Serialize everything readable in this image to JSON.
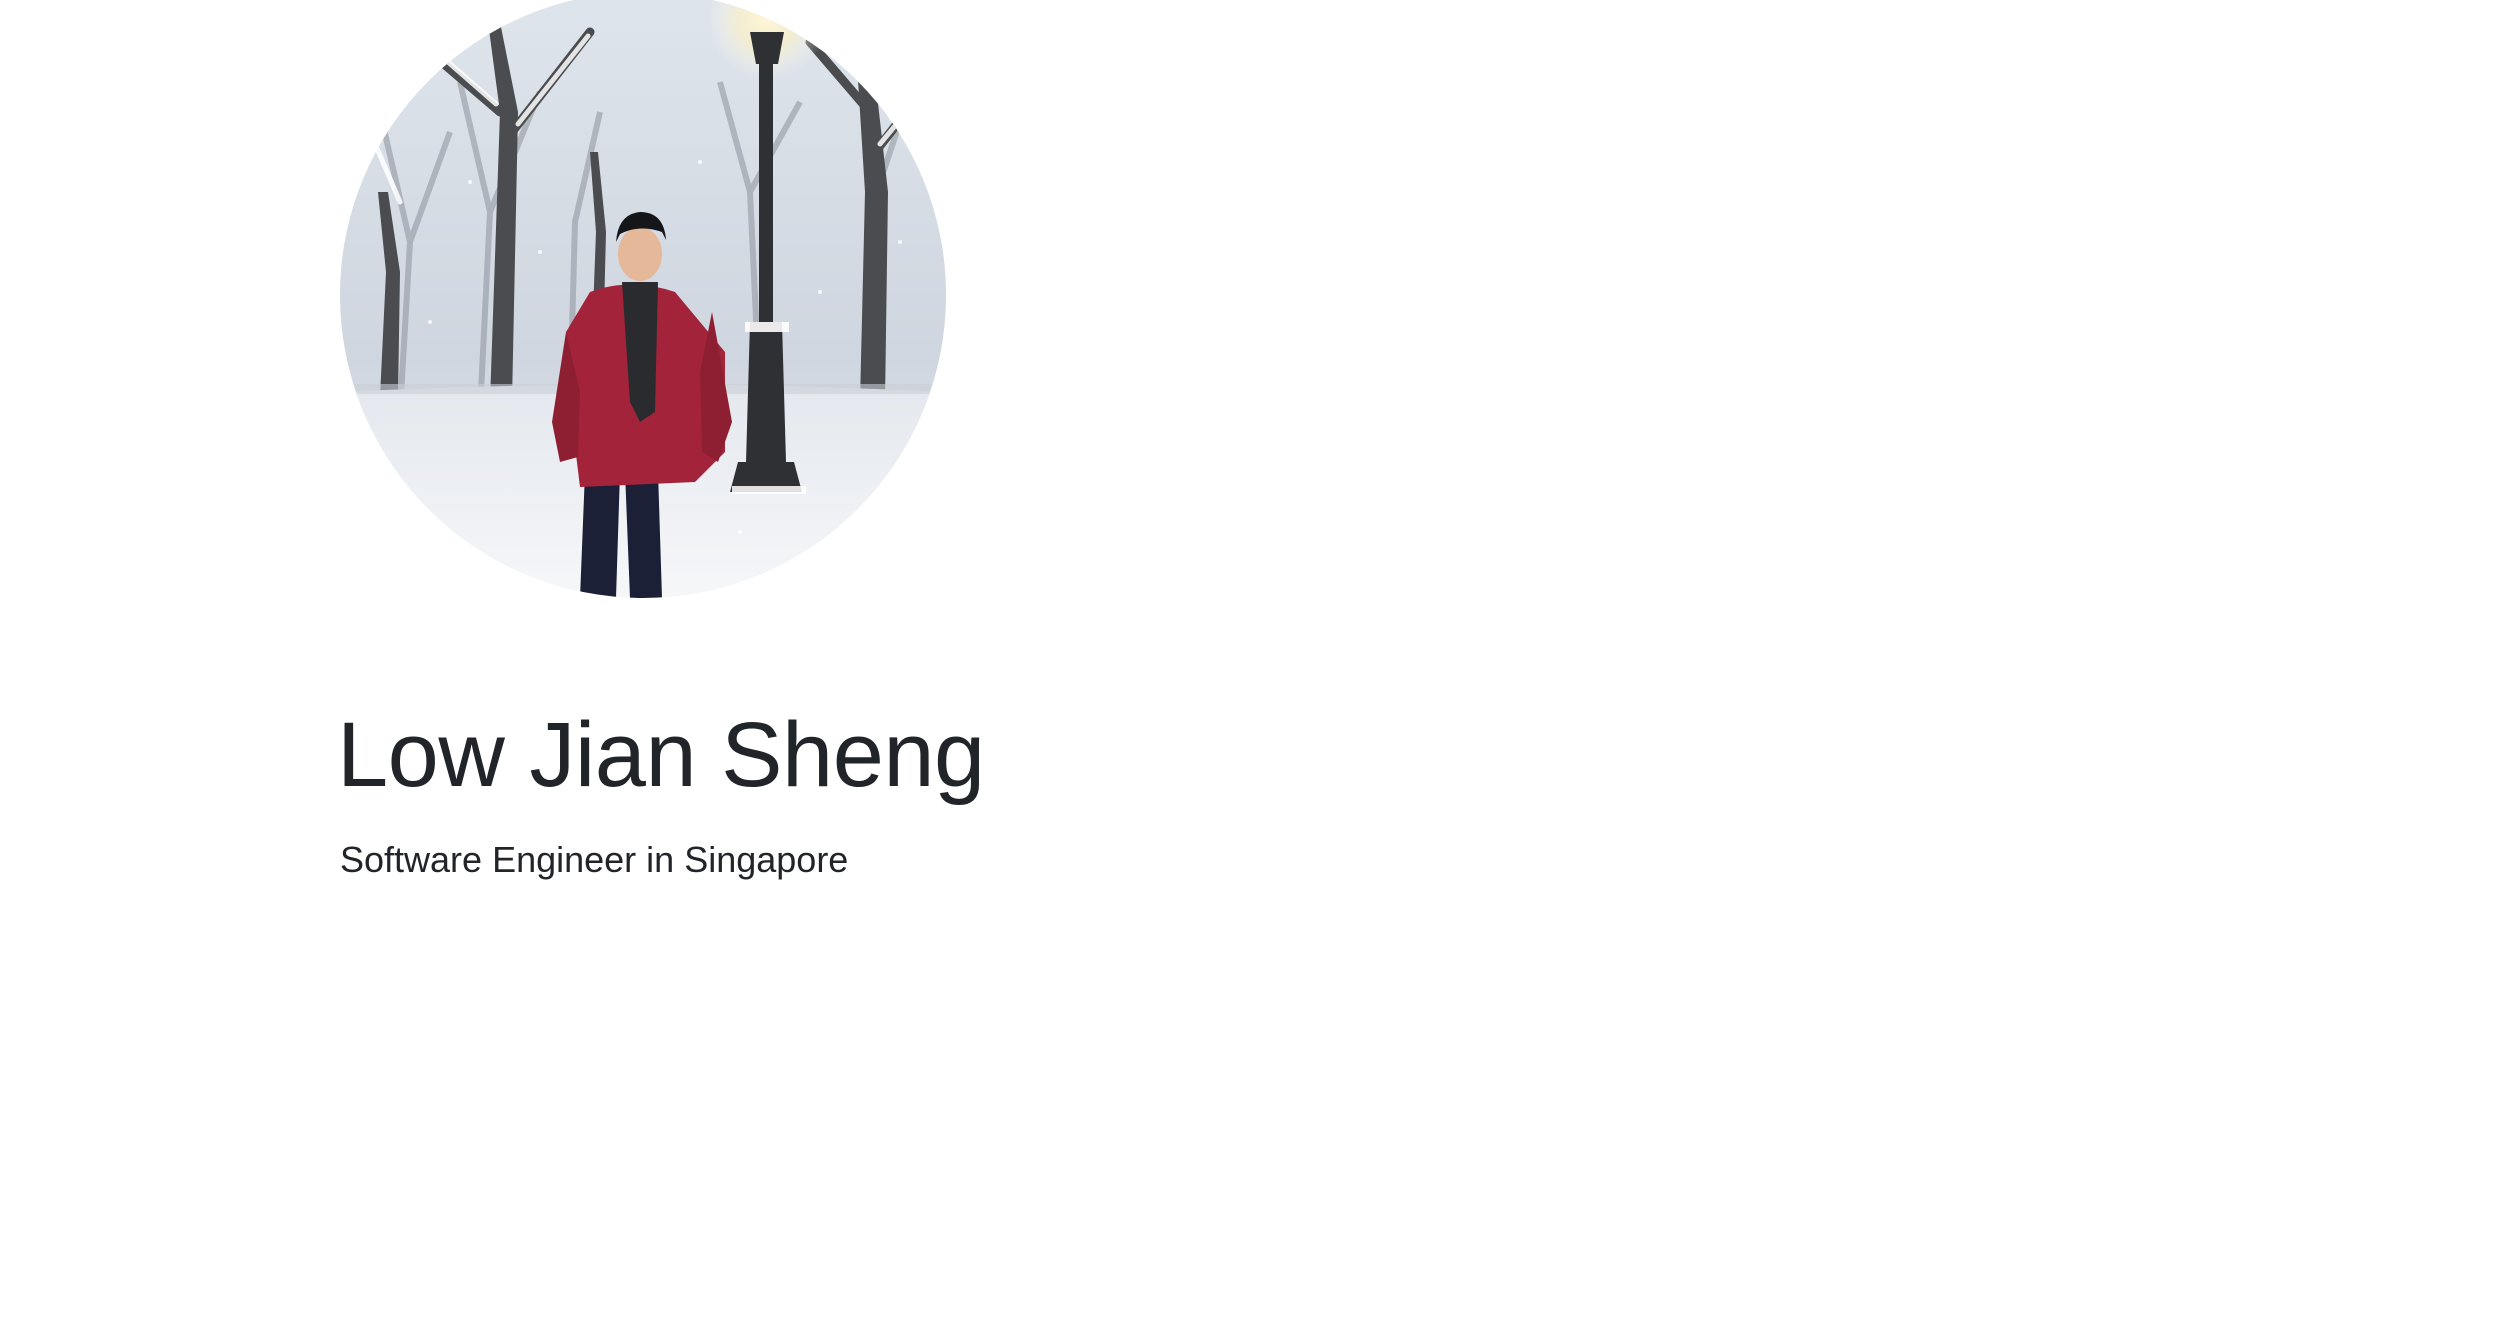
{
  "profile": {
    "photo_alt": "Low Jian Sheng",
    "name": "Low Jian Sheng",
    "tagline": "Software Engineer in Singapore"
  },
  "colors": {
    "text": "#212529",
    "background": "#ffffff",
    "jacket": "#a3243a",
    "snow": "#f3f5f8"
  }
}
